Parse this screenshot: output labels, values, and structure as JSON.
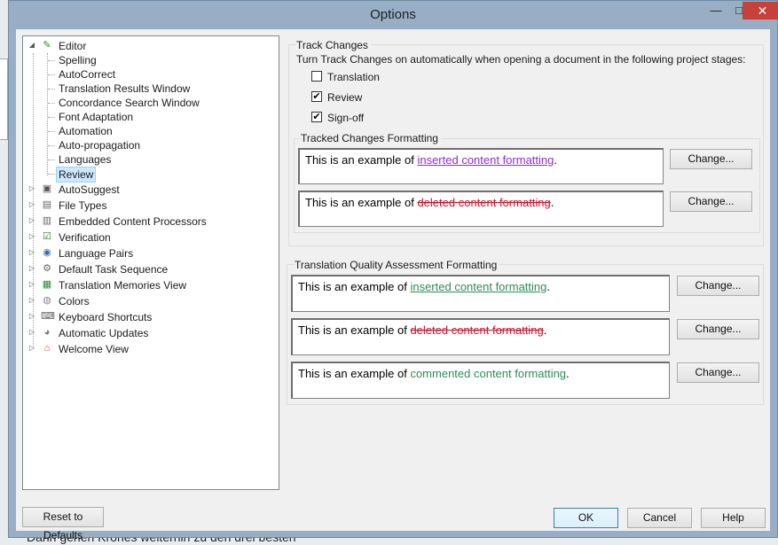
{
  "window": {
    "title": "Options",
    "min_glyph": "—",
    "max_glyph": "□",
    "close_glyph": "✕"
  },
  "background": {
    "bottom_text": "Dann gehen Krones weiterhin zu den drei besten"
  },
  "tree": {
    "root": {
      "label": "Editor",
      "icon": "pencil-icon",
      "color": "#2e8b2e"
    },
    "editor_children": [
      "Spelling",
      "AutoCorrect",
      "Translation Results Window",
      "Concordance Search Window",
      "Font Adaptation",
      "Automation",
      "Auto-propagation",
      "Languages",
      "Review"
    ],
    "selected": "Review",
    "top_items": [
      {
        "label": "AutoSuggest",
        "icon": "autosuggest-icon"
      },
      {
        "label": "File Types",
        "icon": "file-types-icon"
      },
      {
        "label": "Embedded Content Processors",
        "icon": "embedded-content-icon"
      },
      {
        "label": "Verification",
        "icon": "verification-icon"
      },
      {
        "label": "Language Pairs",
        "icon": "language-pairs-icon"
      },
      {
        "label": "Default Task Sequence",
        "icon": "gear-icon"
      },
      {
        "label": "Translation Memories View",
        "icon": "translation-memories-icon"
      },
      {
        "label": "Colors",
        "icon": "colors-icon"
      },
      {
        "label": "Keyboard Shortcuts",
        "icon": "keyboard-icon"
      },
      {
        "label": "Automatic Updates",
        "icon": "globe-icon"
      },
      {
        "label": "Welcome View",
        "icon": "home-icon"
      }
    ]
  },
  "track_changes": {
    "heading": "Track Changes",
    "description": "Turn Track Changes on automatically when opening a document in the following project stages:",
    "options": [
      {
        "label": "Translation",
        "checked": false
      },
      {
        "label": "Review",
        "checked": true
      },
      {
        "label": "Sign-off",
        "checked": true
      }
    ],
    "check_glyph": "✔"
  },
  "tracked_formatting": {
    "heading": "Tracked Changes Formatting",
    "rows": [
      {
        "prefix": "This is an example of ",
        "sample": "inserted content formatting",
        "suffix": ".",
        "button": "Change..."
      },
      {
        "prefix": "This is an example of ",
        "sample": "deleted content formatting",
        "suffix": ".",
        "button": "Change..."
      }
    ]
  },
  "tqa_formatting": {
    "heading": "Translation Quality Assessment Formatting",
    "rows": [
      {
        "prefix": "This is an example of ",
        "sample": "inserted content formatting",
        "suffix": ".",
        "button": "Change..."
      },
      {
        "prefix": "This is an example of ",
        "sample": "deleted content formatting",
        "suffix": ".",
        "button": "Change..."
      },
      {
        "prefix": "This is an example of ",
        "sample": "commented content formatting",
        "suffix": ".",
        "button": "Change..."
      }
    ]
  },
  "footer": {
    "reset": "Reset to Defaults",
    "ok": "OK",
    "cancel": "Cancel",
    "help": "Help"
  }
}
